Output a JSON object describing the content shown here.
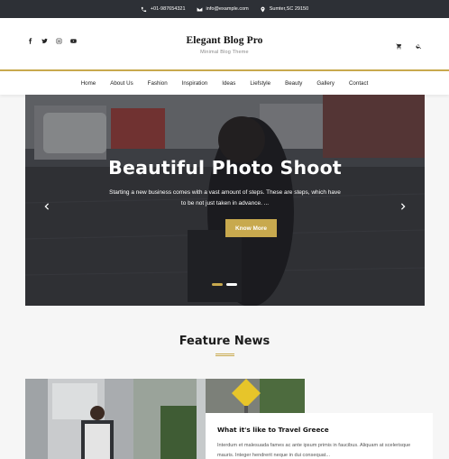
{
  "topbar": {
    "phone": "+01-987654321",
    "email": "info@example.com",
    "address": "Sumter,SC 29150"
  },
  "header": {
    "site_title": "Elegant Blog Pro",
    "tagline": "Minimal Blog Theme",
    "social_icons": [
      "facebook-icon",
      "twitter-icon",
      "instagram-icon",
      "youtube-icon"
    ],
    "right_icons": [
      "cart-icon",
      "search-icon"
    ]
  },
  "nav": {
    "items": [
      "Home",
      "About Us",
      "Fashion",
      "Inspiration",
      "Ideas",
      "Liefstyle",
      "Beauty",
      "Gallery",
      "Contact"
    ]
  },
  "hero": {
    "title": "Beautiful Photo Shoot",
    "text": "Starting a new business comes with a vast amount of steps. These are steps, which have to be not just taken in advance. ...",
    "button_label": "Know More",
    "slide_count": 2,
    "active_slide": 1
  },
  "feature": {
    "title": "Feature News",
    "article": {
      "title": "What it's like to Travel Greece",
      "excerpt": "Interdum et malesuada fames ac ante ipsum primis in faucibus. Aliquam at scelerisque mauris. Integer hendrerit neque in dui consequat..."
    }
  },
  "colors": {
    "accent": "#c8a94e",
    "topbar_bg": "#2d3036"
  }
}
